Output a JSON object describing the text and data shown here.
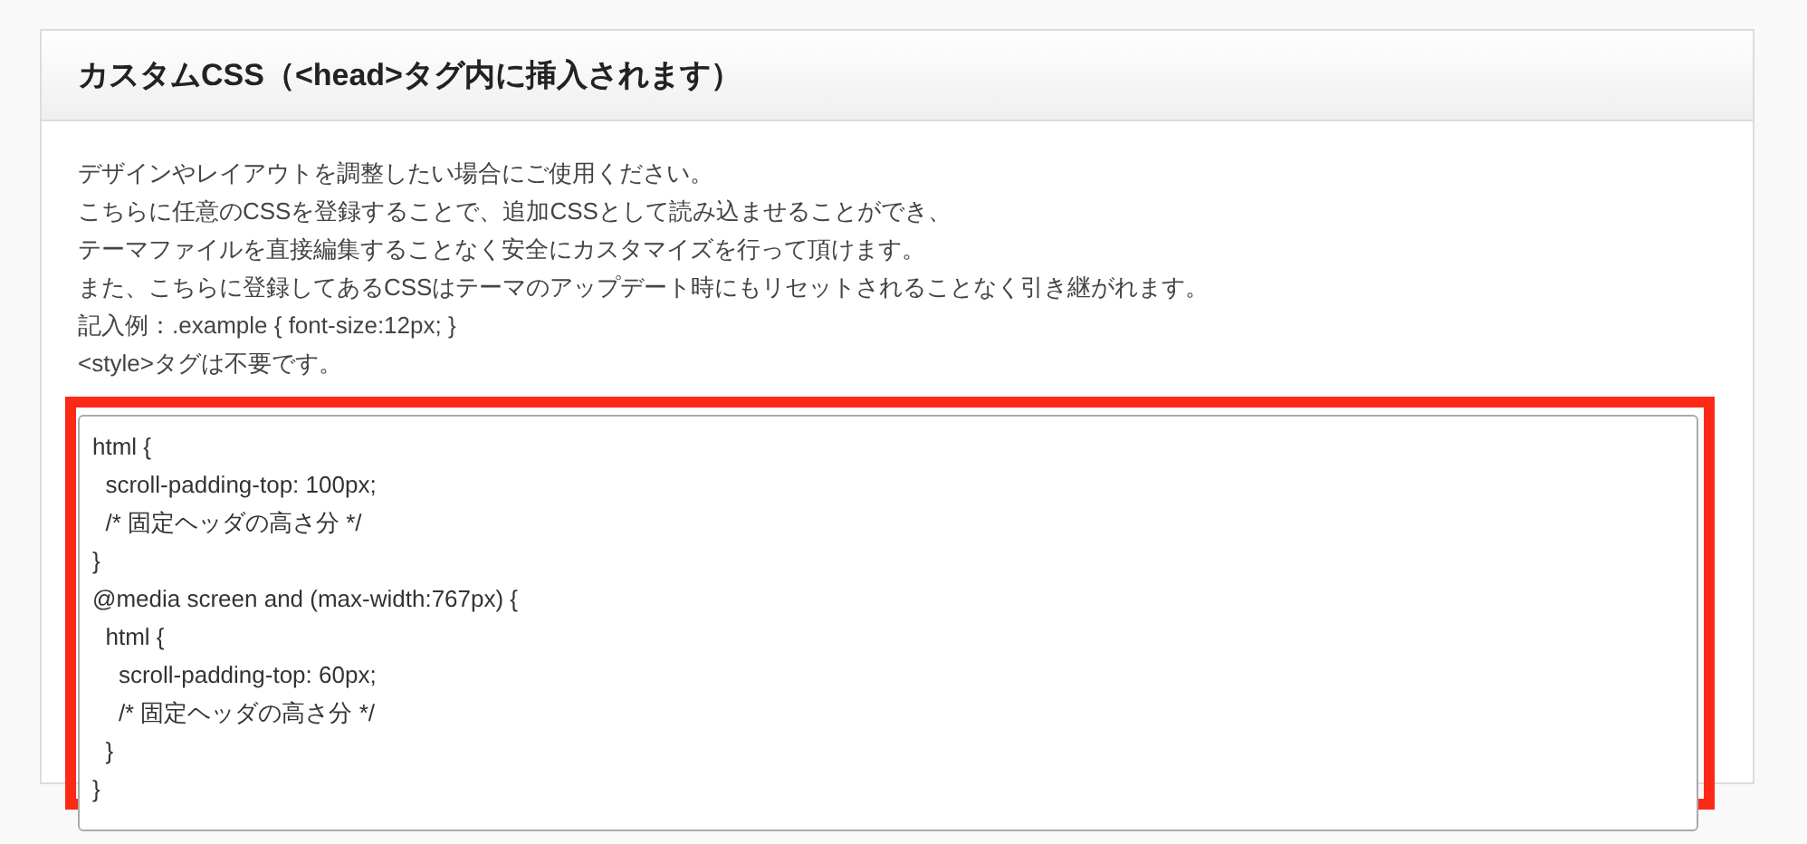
{
  "panel": {
    "title": "カスタムCSS（<head>タグ内に挿入されます）",
    "description": [
      "デザインやレイアウトを調整したい場合にご使用ください。",
      "こちらに任意のCSSを登録することで、追加CSSとして読み込ませることができ、",
      "テーマファイルを直接編集することなく安全にカスタマイズを行って頂けます。",
      "また、こちらに登録してあるCSSはテーマのアップデート時にもリセットされることなく引き継がれます。",
      "記入例：.example { font-size:12px; }",
      "<style>タグは不要です。"
    ],
    "css_field": {
      "value_lines": [
        "html {",
        "  scroll-padding-top: 100px;",
        "  /* 固定ヘッダの高さ分 */",
        "}",
        "@media screen and (max-width:767px) {",
        "  html {",
        "    scroll-padding-top: 60px;",
        "    /* 固定ヘッダの高さ分 */",
        "  }",
        "}"
      ]
    }
  }
}
